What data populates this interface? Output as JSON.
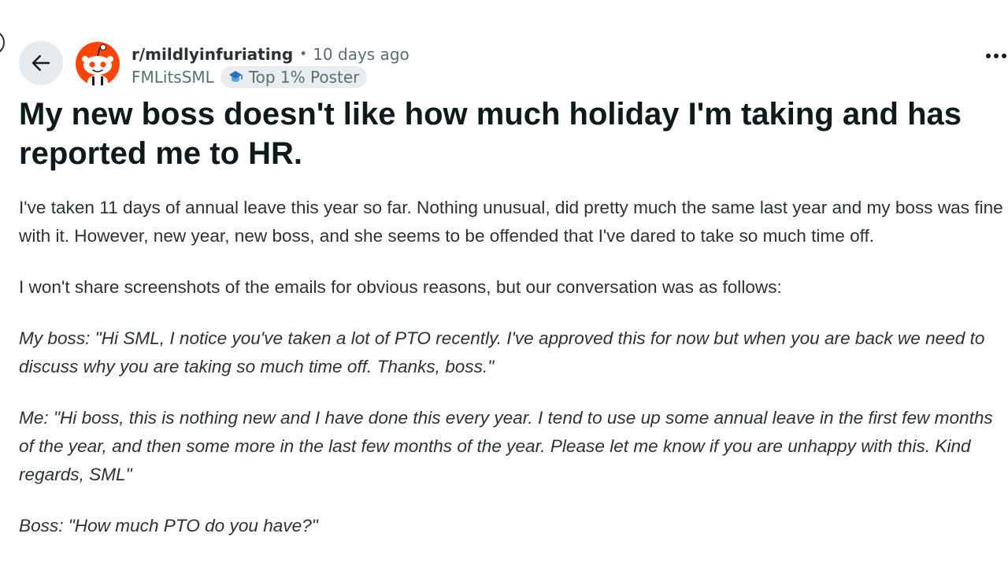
{
  "header": {
    "back_icon": "arrow-left-icon",
    "subreddit": "r/mildlyinfuriating",
    "separator": "•",
    "time_ago": "10 days ago",
    "username": "FMLitsSML",
    "flair_icon": "top-poster-icon",
    "flair": "Top 1% Poster",
    "more_icon": "overflow-menu-icon"
  },
  "colors": {
    "avatar_orange": "#ff4500",
    "back_button_bg": "#e5ebee",
    "flair_bg": "#eaedef",
    "meta_gray": "#576f76",
    "title_text": "#0f1a1c",
    "body_text": "#2a3236"
  },
  "post": {
    "title": "My new boss doesn't like how much holiday I'm taking and has reported me to HR.",
    "paragraphs": [
      "I've taken 11 days of annual leave this year so far. Nothing unusual, did pretty much the same last year and my boss was fine with it. However, new year, new boss, and she seems to be offended that I've dared to take so much time off.",
      "I won't share screenshots of the emails for obvious reasons, but our conversation was as follows:",
      "My boss: \"Hi SML, I notice you've taken a lot of PTO recently. I've approved this for now but when you are back we need to discuss why you are taking so much time off. Thanks, boss.\"",
      "Me: \"Hi boss, this is nothing new and I have done this every year. I tend to use up some annual leave in the first few months of the year, and then some more in the last few months of the year. Please let me know if you are unhappy with this. Kind regards, SML\"",
      "Boss: \"How much PTO do you have?\""
    ]
  }
}
